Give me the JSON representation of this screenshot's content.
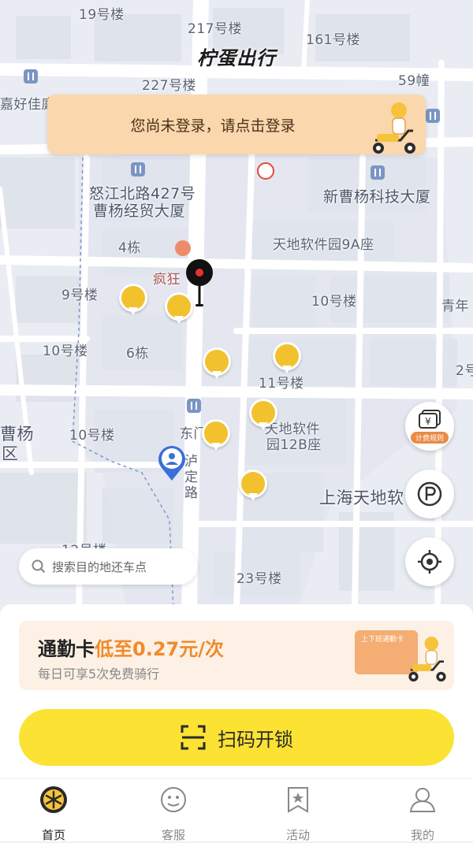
{
  "app": {
    "brand": "柠蛋出行"
  },
  "login_banner": {
    "text": "您尚未登录，请点击登录"
  },
  "map": {
    "labels": {
      "b19": "19号楼",
      "b217": "217号楼",
      "b161": "161号楼",
      "b227": "227号楼",
      "b59": "59幢",
      "jiahao": "嘉好佳庭",
      "nujiang1": "怒江北路427号",
      "nujiang2": "曹杨经贸大厦",
      "xincaoyang": "新曹杨科技大厦",
      "tiandi9a": "天地软件园9A座",
      "b4": "4栋",
      "fengkuang": "疯狂",
      "b9": "9号楼",
      "b10a": "10号楼",
      "qingnian": "青年",
      "b10b": "10号楼",
      "b6": "6栋",
      "b11": "11号楼",
      "b2": "2号",
      "caoyang1": "曹杨",
      "caoyang2": "区",
      "b10c": "10号楼",
      "dongmen": "东门",
      "tiandi12b1": "天地软件",
      "tiandi12b2": "园12B座",
      "luding": "泸定路",
      "shanghaitiandi": "上海天地软",
      "b12": "12号楼",
      "b23": "23号楼"
    }
  },
  "map_buttons": {
    "fee_rules": "计费规则",
    "fee_symbol": "¥"
  },
  "search": {
    "placeholder": "搜索目的地还车点"
  },
  "promo": {
    "title": "通勤卡",
    "highlight": "低至0.27元/次",
    "subtitle": "每日可享5次免费骑行",
    "card_label": "上下班通勤卡"
  },
  "scan": {
    "label": "扫码开锁"
  },
  "tabs": [
    {
      "label": "首页",
      "icon": "home-icon"
    },
    {
      "label": "客服",
      "icon": "service-icon"
    },
    {
      "label": "活动",
      "icon": "activity-icon"
    },
    {
      "label": "我的",
      "icon": "profile-icon"
    }
  ],
  "colors": {
    "accent": "#FBE233",
    "promo_highlight": "#F08A2B",
    "banner": "#FBD7AD",
    "pin": "#F2C12E"
  }
}
